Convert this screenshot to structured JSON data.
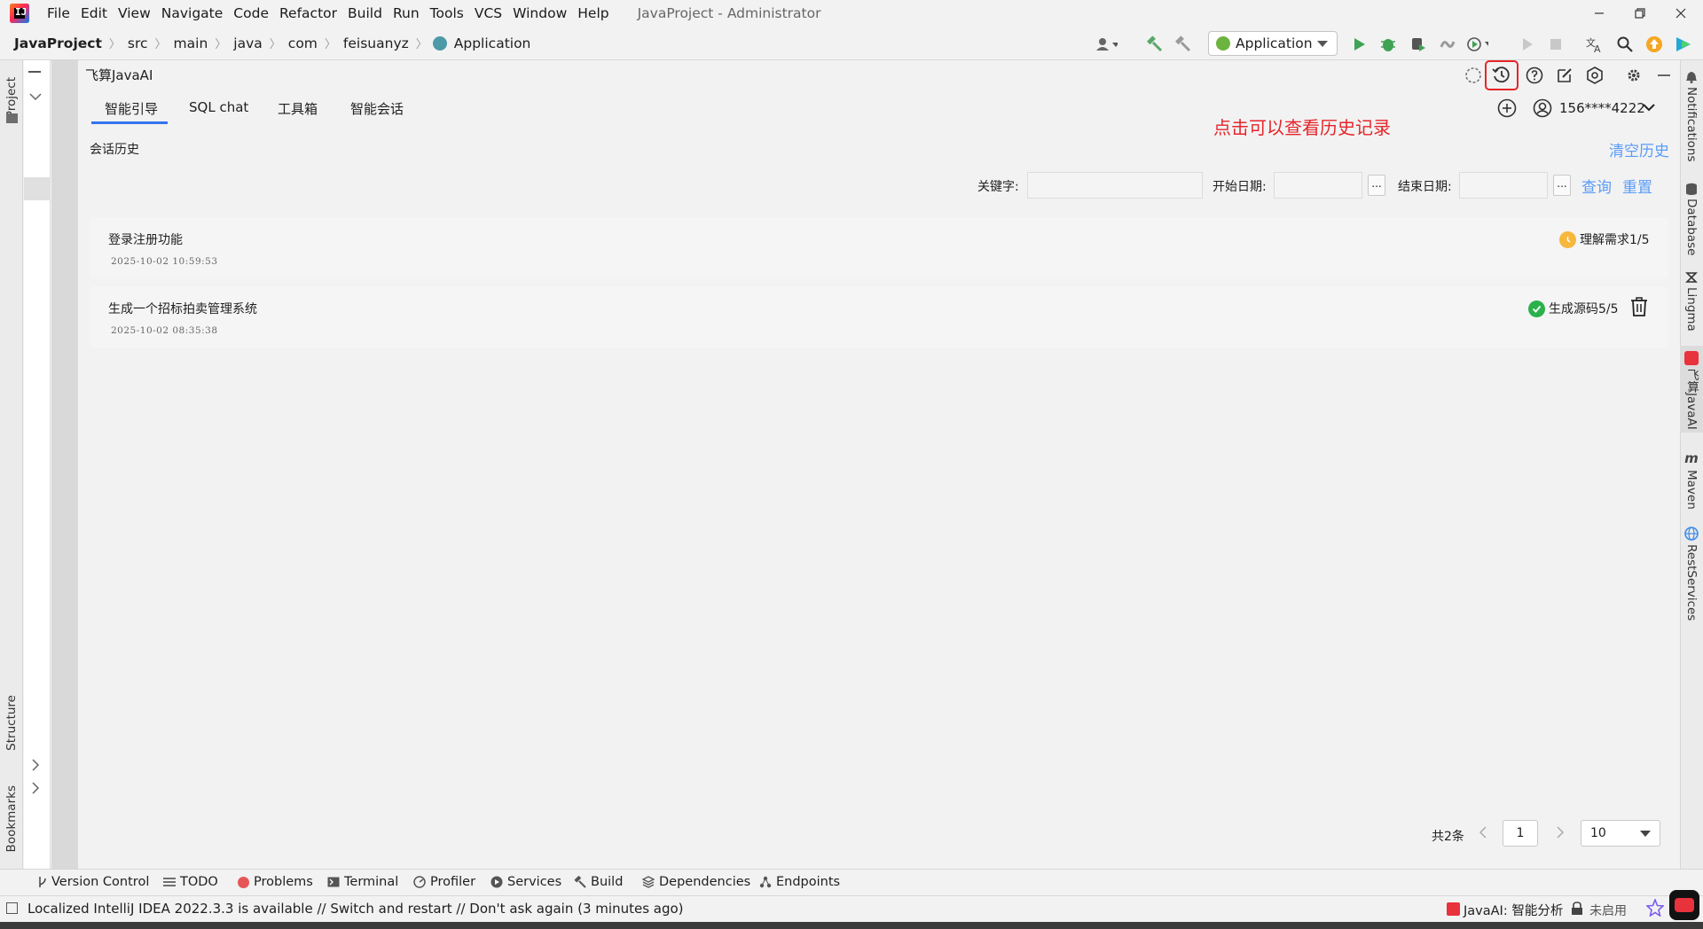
{
  "app": {
    "window_title": "JavaProject - Administrator"
  },
  "menu": [
    "File",
    "Edit",
    "View",
    "Navigate",
    "Code",
    "Refactor",
    "Build",
    "Run",
    "Tools",
    "VCS",
    "Window",
    "Help"
  ],
  "breadcrumb": [
    "JavaProject",
    "src",
    "main",
    "java",
    "com",
    "feisuanyz",
    "Application"
  ],
  "run_config": "Application",
  "side_tabs": {
    "left_top": "Project",
    "left_structure": "Structure",
    "left_bookmarks": "Bookmarks"
  },
  "right_tabs": [
    "Notifications",
    "Database",
    "Lingma",
    "飞算JavaAI",
    "Maven",
    "RestServices"
  ],
  "plugin": {
    "title": "飞算JavaAI",
    "tabs": [
      "智能引导",
      "SQL chat",
      "工具箱",
      "智能会话"
    ],
    "active_tab": "智能引导",
    "annotation": "点击可以查看历史记录",
    "user": "156****4222",
    "history_heading": "会话历史",
    "clear_history": "清空历史",
    "filter": {
      "keyword_label": "关键字:",
      "start_label": "开始日期:",
      "end_label": "结束日期:",
      "picker": "...",
      "search": "查询",
      "reset": "重置"
    },
    "records": [
      {
        "title": "登录注册功能",
        "time": "2025-10-02 10:59:53",
        "status": "理解需求1/5",
        "status_color": "#f6b73c"
      },
      {
        "title": "生成一个招标拍卖管理系统",
        "time": "2025-10-02 08:35:38",
        "status": "生成源码5/5",
        "status_color": "#2bb14c"
      }
    ],
    "pagination": {
      "total": "共2条",
      "page": "1",
      "page_size": "10"
    }
  },
  "bottom_tools": [
    "Version Control",
    "TODO",
    "Problems",
    "Terminal",
    "Profiler",
    "Services",
    "Build",
    "Dependencies",
    "Endpoints"
  ],
  "status": {
    "message": "Localized IntelliJ IDEA 2022.3.3 is available // Switch and restart // Don't ask again (3 minutes ago)",
    "javaai": "JavaAI: 智能分析",
    "disabled": "未启用"
  },
  "colors": {
    "accent": "#3574f0",
    "link": "#5a9cf8",
    "annotation": "#e5252a",
    "highlight_box": "#e5252a"
  }
}
